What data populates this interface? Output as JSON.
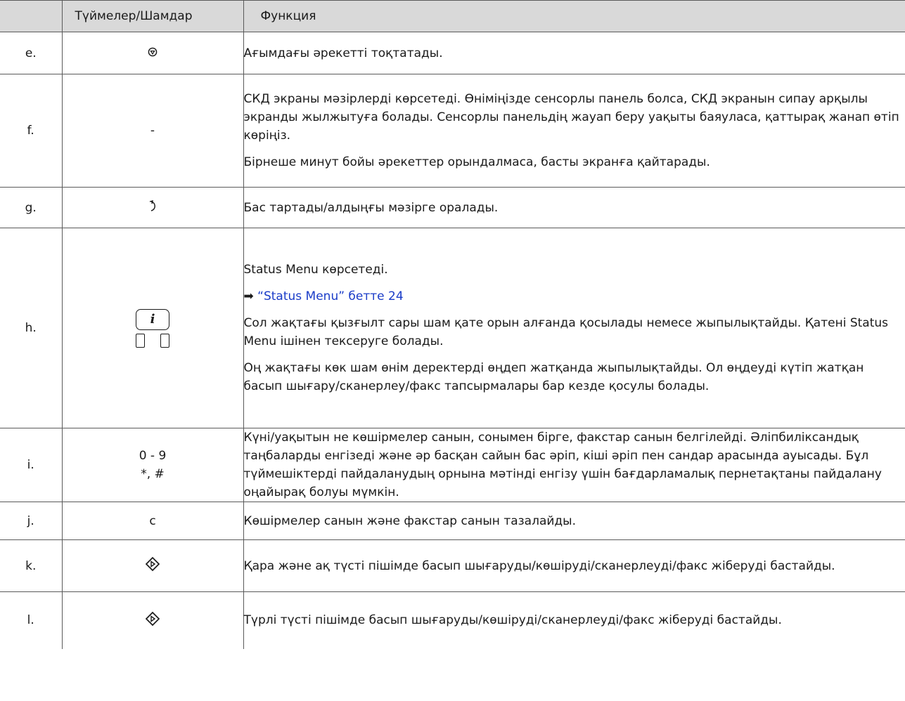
{
  "table": {
    "headers": {
      "key": "",
      "button": "Түймелер/Шамдар",
      "function": "Функция"
    },
    "rows": [
      {
        "key": "e.",
        "button_icon": "stop-icon",
        "button_text": "⊚",
        "func": [
          "Ағымдағы әрекетті тоқтатады."
        ]
      },
      {
        "key": "f.",
        "button_text": "-",
        "func": [
          "СКД экраны мәзірлерді көрсетеді. Өніміңізде сенсорлы панель болса, СКД экранын сипау арқылы экранды жылжытуға болады. Сенсорлы панельдің жауап беру уақыты баяуласа, қаттырақ жанап өтіп көріңіз.",
          "Бірнеше минут бойы әрекеттер орындалмаса, басты экранға қайтарады."
        ]
      },
      {
        "key": "g.",
        "button_icon": "back-icon",
        "button_text": "↶",
        "func": [
          "Бас тартады/алдыңғы мәзірге оралады."
        ]
      },
      {
        "key": "h.",
        "button_icon": "info-icon",
        "button_text": "i",
        "func": [
          "Status Menu көрсетеді.",
          "Сол жақтағы қызғылт сары шам қате орын алғанда қосылады немесе жыпылықтайды. Қатені Status Menu ішінен тексеруге болады.",
          "Оң жақтағы көк шам өнім деректерді өңдеп жатқанда жыпылықтайды. Ол өңдеуді күтіп жатқан басып шығару/сканерлеу/факс тапсырмалары бар кезде қосулы болады."
        ],
        "link_arrow": "➡",
        "link_text": "“Status Menu” бетте 24"
      },
      {
        "key": "i.",
        "button_text": "0 - 9",
        "button_text2": "*, #",
        "func": [
          "Күні/уақытын не көшірмелер санын, сонымен бірге, факстар санын белгілейді. Әліпбилік­сандық таңбаларды енгізеді және әр басқан сайын бас әріп, кіші әріп пен сандар арасында ауысады. Бұл түймешіктерді пайдаланудың орнына мәтінді енгізу үшін бағдарламалық пернетақтаны пайдалану оңайырақ болуы мүмкін."
        ]
      },
      {
        "key": "j.",
        "button_text": "c",
        "func": [
          "Көшірмелер санын және факстар санын тазалайды."
        ]
      },
      {
        "key": "k.",
        "button_icon": "start-bw-icon",
        "button_text": "◇",
        "func": [
          "Қара және ақ түсті пішімде басып шығаруды/көшіруді/сканерлеуді/факс жіберуді бастайды."
        ]
      },
      {
        "key": "l.",
        "button_icon": "start-color-icon",
        "button_text": "◇",
        "func": [
          "Түрлі түсті пішімде басып шығаруды/көшіруді/сканерлеуді/факс жіберуді бастайды."
        ]
      }
    ]
  }
}
